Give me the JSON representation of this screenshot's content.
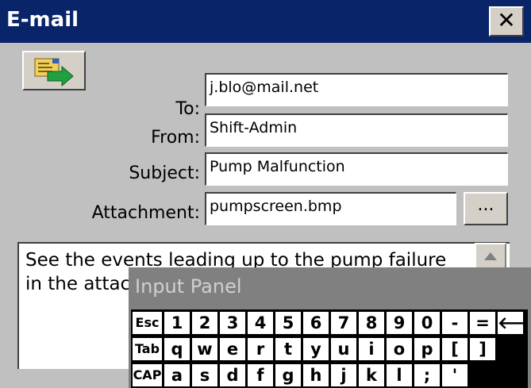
{
  "window": {
    "title": "E-mail",
    "close_glyph": "✕"
  },
  "toolbar": {
    "send_icon": "send-email-icon"
  },
  "form": {
    "to_label": "To:",
    "to_value": "j.blo@mail.net",
    "from_label": "From:",
    "from_value": "Shift-Admin",
    "subject_label": "Subject:",
    "subject_value": "Pump Malfunction",
    "attachment_label": "Attachment:",
    "attachment_value": "pumpscreen.bmp",
    "browse_label": "...",
    "body_text": "See the events leading up to the pump failure in the attac"
  },
  "input_panel": {
    "title": "Input Panel",
    "rows": [
      [
        "Esc",
        "1",
        "2",
        "3",
        "4",
        "5",
        "6",
        "7",
        "8",
        "9",
        "0",
        "-",
        "=",
        "🡐"
      ],
      [
        "Tab",
        "q",
        "w",
        "e",
        "r",
        "t",
        "y",
        "u",
        "i",
        "o",
        "p",
        "[",
        "]"
      ],
      [
        "CAP",
        "a",
        "s",
        "d",
        "f",
        "g",
        "h",
        "j",
        "k",
        "l",
        ";",
        "'"
      ]
    ]
  },
  "colors": {
    "titlebar": "#0a246a",
    "window_bg": "#c0c0c0",
    "panel_bg": "#808080"
  }
}
